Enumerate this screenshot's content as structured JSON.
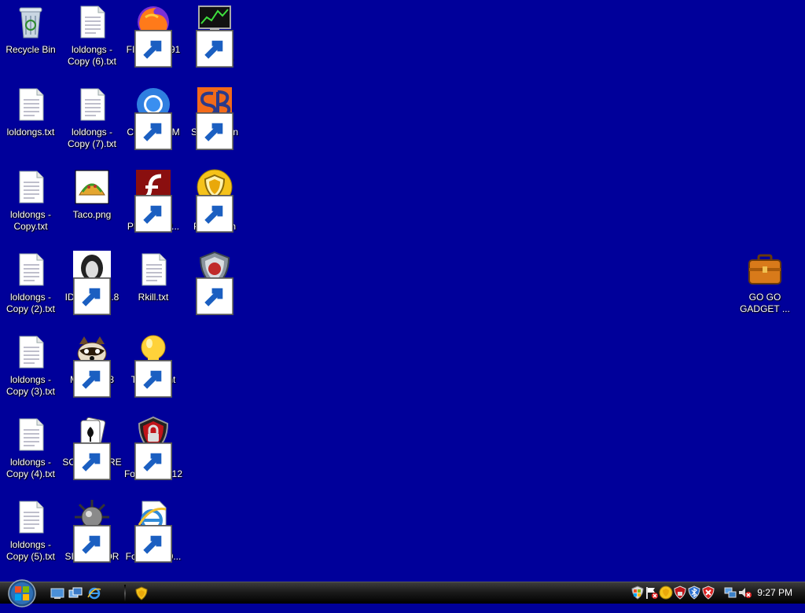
{
  "desktop": {
    "icons": [
      {
        "label": "Recycle Bin"
      },
      {
        "label": "loldongs - Copy (6).txt"
      },
      {
        "label": "FIREFOX 91"
      },
      {
        "label": "Process Hacker 2"
      },
      {
        "label": "loldongs.txt"
      },
      {
        "label": "loldongs - Copy (7).txt"
      },
      {
        "label": "CHROMIUM 101"
      },
      {
        "label": "SmartBoan"
      },
      {
        "label": "loldongs - Copy.txt"
      },
      {
        "label": "Taco.png"
      },
      {
        "label": "FLASH PLAYER P..."
      },
      {
        "label": "Malware Protection"
      },
      {
        "label": "loldongs - Copy (2).txt"
      },
      {
        "label": "IDA PRO 6.8"
      },
      {
        "label": "Rkill.txt"
      },
      {
        "label": "Internet Security"
      },
      {
        "label": "loldongs - Copy (3).txt"
      },
      {
        "label": "MYPAL 68"
      },
      {
        "label": "ThinkPoint"
      },
      {
        "label": "loldongs - Copy (4).txt"
      },
      {
        "label": "SO LIT!! AIRE"
      },
      {
        "label": "Smart Fortress 2012"
      },
      {
        "label": "loldongs - Copy (5).txt"
      },
      {
        "label": "BOSNIA SIMULATOR"
      },
      {
        "label": "Smart Fortress 20..."
      },
      {
        "label": "GO GO GADGET ..."
      }
    ]
  },
  "taskbar": {
    "clock": "9:27 PM"
  },
  "colors": {
    "desktop_background": "#00009a",
    "taskbar": "#1b1b1b"
  }
}
